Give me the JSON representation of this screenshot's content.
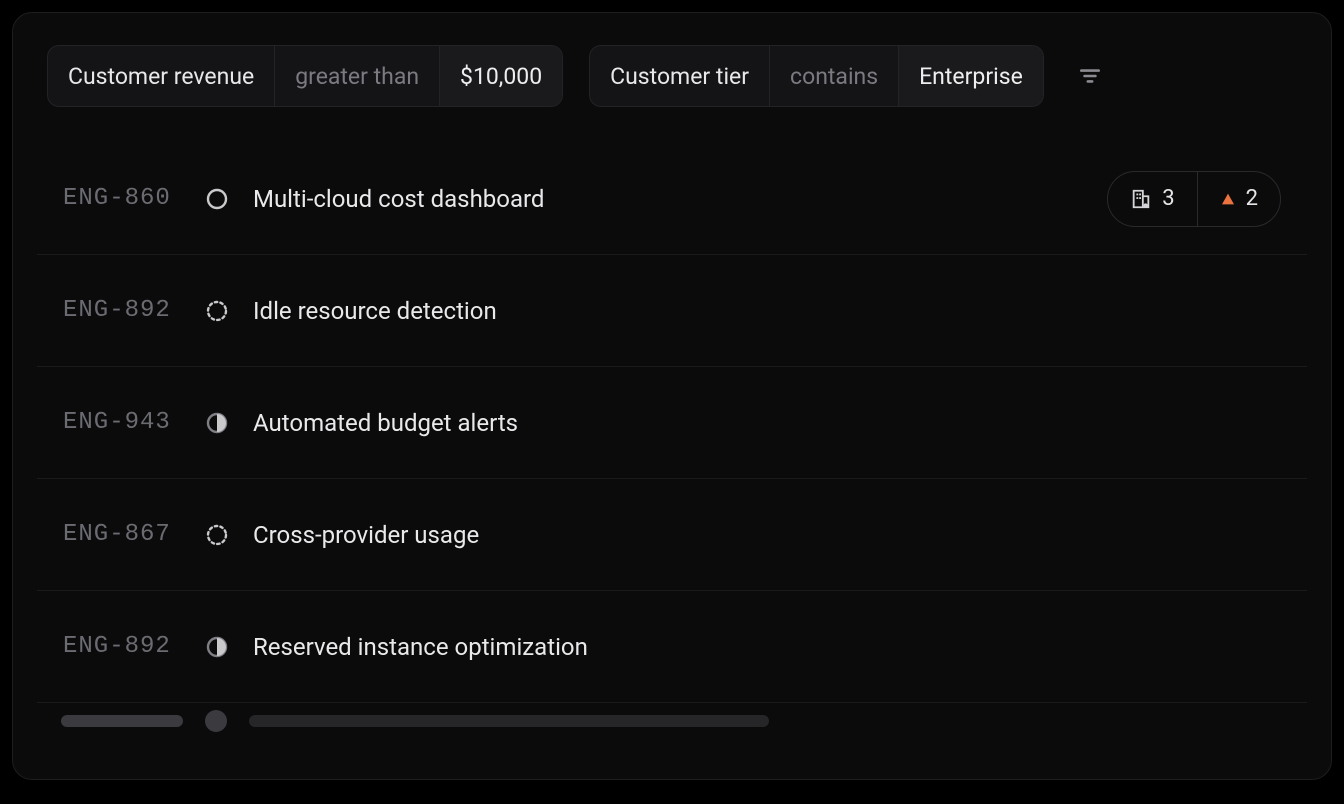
{
  "filters": [
    {
      "attribute": "Customer revenue",
      "operator": "greater than",
      "value": "$10,000"
    },
    {
      "attribute": "Customer tier",
      "operator": "contains",
      "value": "Enterprise"
    }
  ],
  "issues": [
    {
      "id": "ENG-860",
      "status": "circle",
      "title": "Multi-cloud cost dashboard",
      "badges": {
        "customers": 3,
        "priority_high": 2
      }
    },
    {
      "id": "ENG-892",
      "status": "backlog",
      "title": "Idle resource detection"
    },
    {
      "id": "ENG-943",
      "status": "half",
      "title": "Automated budget alerts"
    },
    {
      "id": "ENG-867",
      "status": "backlog",
      "title": "Cross-provider usage"
    },
    {
      "id": "ENG-892",
      "status": "half",
      "title": "Reserved instance optimization"
    }
  ],
  "colors": {
    "priority_high": "#ea7340"
  }
}
